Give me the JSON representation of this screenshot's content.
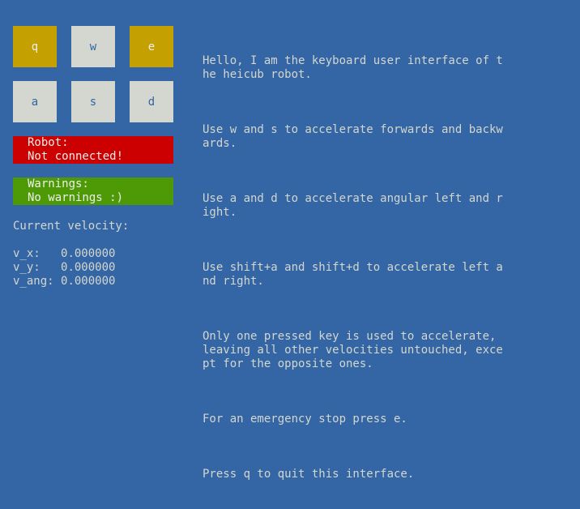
{
  "keys": [
    {
      "label": "q",
      "active": true
    },
    {
      "label": "w",
      "active": false
    },
    {
      "label": "e",
      "active": true
    },
    {
      "label": "a",
      "active": false
    },
    {
      "label": "s",
      "active": false
    },
    {
      "label": "d",
      "active": false
    }
  ],
  "robot": {
    "line1": "Robot:",
    "line2": "Not connected!"
  },
  "warnings": {
    "line1": "Warnings:",
    "line2": "No warnings :)"
  },
  "velocity": {
    "label": "Current velocity:",
    "vx_label": "v_x:   ",
    "vx": "0.000000",
    "vy_label": "v_y:   ",
    "vy": "0.000000",
    "vang_label": "v_ang: ",
    "vang": "0.000000"
  },
  "help": [
    "Hello, I am the keyboard user interface of t\nhe heicub robot.",
    "Use w and s to accelerate forwards and backw\nards.",
    "Use a and d to accelerate angular left and r\night.",
    "Use shift+a and shift+d to accelerate left a\nnd right.",
    "Only one pressed key is used to accelerate,\nleaving all other velocities untouched, exce\npt for the opposite ones.",
    "For an emergency stop press e.",
    "Press q to quit this interface."
  ],
  "colors": {
    "background": "#3465a4",
    "key_active": "#c4a000",
    "key_idle": "#d3d7cf",
    "robot_status": "#cc0000",
    "warning_status": "#4e9a06"
  }
}
